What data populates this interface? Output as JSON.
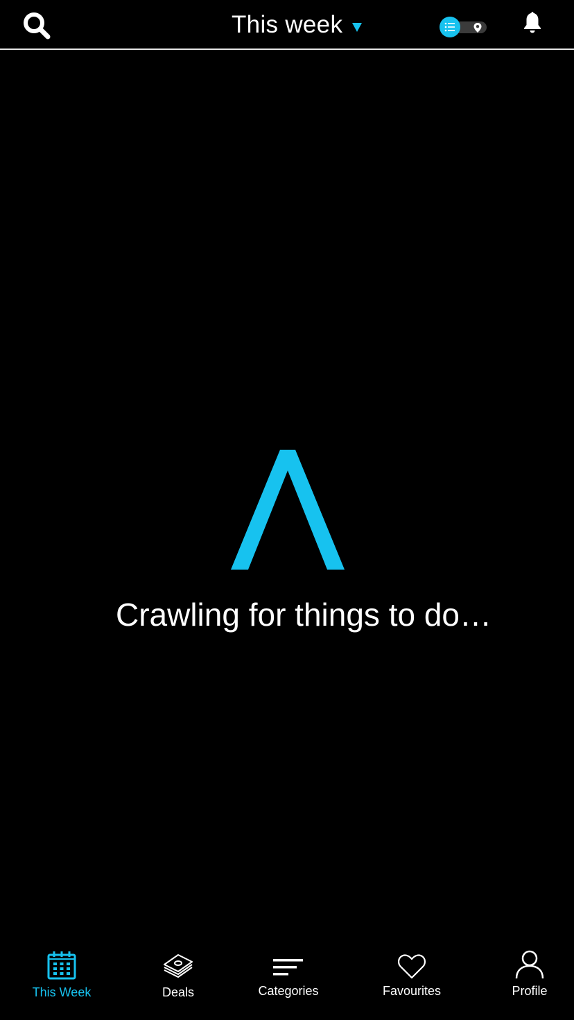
{
  "header": {
    "title": "This week",
    "search_icon": "search-icon",
    "caret_icon": "caret-down-icon",
    "toggle": {
      "state": "list",
      "left_icon": "list-icon",
      "right_icon": "map-pin-icon"
    },
    "bell_icon": "bell-icon"
  },
  "loading": {
    "logo_icon": "caret-logo-icon",
    "message": "Crawling for things to do…"
  },
  "nav": {
    "items": [
      {
        "label": "This Week",
        "icon": "calendar-icon",
        "active": true
      },
      {
        "label": "Deals",
        "icon": "deals-icon",
        "active": false
      },
      {
        "label": "Categories",
        "icon": "categories-icon",
        "active": false
      },
      {
        "label": "Favourites",
        "icon": "heart-icon",
        "active": false
      },
      {
        "label": "Profile",
        "icon": "profile-icon",
        "active": false
      }
    ]
  },
  "colors": {
    "accent": "#17c2ef",
    "background": "#000000",
    "text": "#ffffff",
    "toggle_track": "#3b3b3b"
  }
}
